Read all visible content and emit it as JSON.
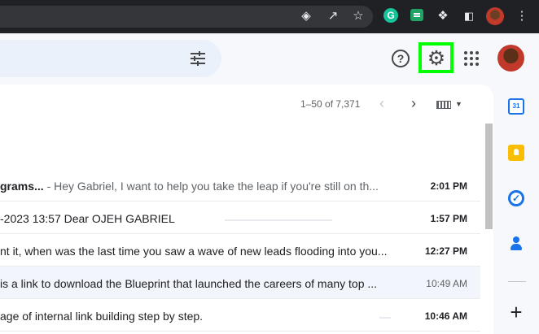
{
  "chrome": {
    "icons": [
      "eye-icon",
      "share-icon",
      "bookmark-star-icon",
      "grammarly-extension-icon",
      "chat-extension-icon",
      "extensions-puzzle-icon",
      "side-panel-icon",
      "profile-avatar",
      "more-menu-icon"
    ],
    "grammarly_letter": "G"
  },
  "header": {
    "search_options_icon": "tune-icon",
    "help_icon": "help-icon",
    "settings_icon": "gear-icon",
    "apps_icon": "apps-grid-icon",
    "highlight_color": "#00ff00"
  },
  "toolbar": {
    "pagination": "1–50 of 7,371",
    "prev_icon": "chevron-left-icon",
    "next_icon": "chevron-right-icon",
    "input_tools_icon": "keyboard-icon"
  },
  "emails": [
    {
      "subject": "grams...",
      "snippet": " - Hey Gabriel, I want to help you take the leap if you're still on th...",
      "time": "2:01 PM",
      "unread": true
    },
    {
      "subject": "",
      "snippet": "-2023 13:57 Dear OJEH GABRIEL",
      "time": "1:57 PM",
      "unread": true
    },
    {
      "subject": "",
      "snippet": "nt it, when was the last time you saw a wave of new leads flooding into you...",
      "time": "12:27 PM",
      "unread": true
    },
    {
      "subject": "",
      "snippet": "is a link to download the Blueprint that launched the careers of many top ...",
      "time": "10:49 AM",
      "unread": false
    },
    {
      "subject": "",
      "snippet": "age of internal link building step by step.",
      "time": "10:46 AM",
      "unread": true
    }
  ],
  "side_panel": {
    "calendar_label": "31",
    "apps": [
      "calendar-icon",
      "keep-icon",
      "tasks-icon",
      "contacts-icon"
    ],
    "add_label": "+"
  }
}
